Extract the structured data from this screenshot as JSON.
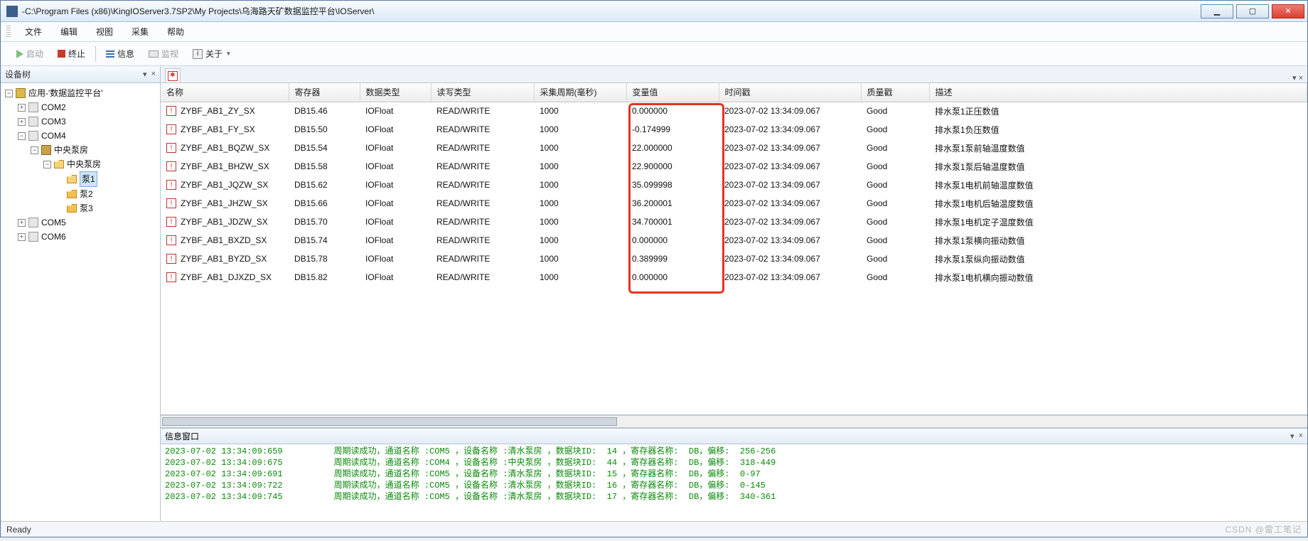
{
  "window": {
    "title": "-C:\\Program Files (x86)\\KingIOServer3.7SP2\\My Projects\\乌海路天矿数据监控平台\\IOServer\\",
    "min": "▁",
    "max": "▢",
    "close": "✕"
  },
  "menu": {
    "items": [
      "文件",
      "编辑",
      "视图",
      "采集",
      "帮助"
    ]
  },
  "toolbar": {
    "start": "启动",
    "stop": "终止",
    "info": "信息",
    "monitor": "监视",
    "about": "关于"
  },
  "sidebar": {
    "title": "设备树",
    "pin": "▾",
    "close": "×",
    "root": "应用-'数据监控平台'",
    "nodes": [
      "COM2",
      "COM3",
      "COM4",
      "COM5",
      "COM6"
    ],
    "com4": {
      "dev1": "中央泵房",
      "dev2": "中央泵房",
      "p1": "泵1",
      "p2": "泵2",
      "p3": "泵3"
    },
    "selected": "泵1"
  },
  "grid": {
    "headers": {
      "name": "名称",
      "reg": "寄存器",
      "dt": "数据类型",
      "rw": "读写类型",
      "per": "采集周期(毫秒)",
      "val": "变量值",
      "ts": "时间戳",
      "q": "质量戳",
      "desc": "描述"
    },
    "rows": [
      {
        "name": "ZYBF_AB1_ZY_SX",
        "reg": "DB15.46",
        "dt": "IOFloat",
        "rw": "READ/WRITE",
        "per": "1000",
        "val": "0.000000",
        "ts": "2023-07-02 13:34:09.067",
        "q": "Good",
        "desc": "排水泵1正压数值"
      },
      {
        "name": "ZYBF_AB1_FY_SX",
        "reg": "DB15.50",
        "dt": "IOFloat",
        "rw": "READ/WRITE",
        "per": "1000",
        "val": "-0.174999",
        "ts": "2023-07-02 13:34:09.067",
        "q": "Good",
        "desc": "排水泵1负压数值"
      },
      {
        "name": "ZYBF_AB1_BQZW_SX",
        "reg": "DB15.54",
        "dt": "IOFloat",
        "rw": "READ/WRITE",
        "per": "1000",
        "val": "22.000000",
        "ts": "2023-07-02 13:34:09.067",
        "q": "Good",
        "desc": "排水泵1泵前轴温度数值"
      },
      {
        "name": "ZYBF_AB1_BHZW_SX",
        "reg": "DB15.58",
        "dt": "IOFloat",
        "rw": "READ/WRITE",
        "per": "1000",
        "val": "22.900000",
        "ts": "2023-07-02 13:34:09.067",
        "q": "Good",
        "desc": "排水泵1泵后轴温度数值"
      },
      {
        "name": "ZYBF_AB1_JQZW_SX",
        "reg": "DB15.62",
        "dt": "IOFloat",
        "rw": "READ/WRITE",
        "per": "1000",
        "val": "35.099998",
        "ts": "2023-07-02 13:34:09.067",
        "q": "Good",
        "desc": "排水泵1电机前轴温度数值"
      },
      {
        "name": "ZYBF_AB1_JHZW_SX",
        "reg": "DB15.66",
        "dt": "IOFloat",
        "rw": "READ/WRITE",
        "per": "1000",
        "val": "36.200001",
        "ts": "2023-07-02 13:34:09.067",
        "q": "Good",
        "desc": "排水泵1电机后轴温度数值"
      },
      {
        "name": "ZYBF_AB1_JDZW_SX",
        "reg": "DB15.70",
        "dt": "IOFloat",
        "rw": "READ/WRITE",
        "per": "1000",
        "val": "34.700001",
        "ts": "2023-07-02 13:34:09.067",
        "q": "Good",
        "desc": "排水泵1电机定子温度数值"
      },
      {
        "name": "ZYBF_AB1_BXZD_SX",
        "reg": "DB15.74",
        "dt": "IOFloat",
        "rw": "READ/WRITE",
        "per": "1000",
        "val": "0.000000",
        "ts": "2023-07-02 13:34:09.067",
        "q": "Good",
        "desc": "排水泵1泵横向振动数值"
      },
      {
        "name": "ZYBF_AB1_BYZD_SX",
        "reg": "DB15.78",
        "dt": "IOFloat",
        "rw": "READ/WRITE",
        "per": "1000",
        "val": "0.389999",
        "ts": "2023-07-02 13:34:09.067",
        "q": "Good",
        "desc": "排水泵1泵纵向振动数值"
      },
      {
        "name": "ZYBF_AB1_DJXZD_SX",
        "reg": "DB15.82",
        "dt": "IOFloat",
        "rw": "READ/WRITE",
        "per": "1000",
        "val": "0.000000",
        "ts": "2023-07-02 13:34:09.067",
        "q": "Good",
        "desc": "排水泵1电机横向振动数值"
      }
    ]
  },
  "info": {
    "title": "信息窗口",
    "pin": "▾",
    "close": "×",
    "lines": [
      {
        "ts": "2023-07-02 13:34:09:659",
        "msg": "周期读成功，通道名称 :COM5 ，设备名称 :清水泵房 ，数据块ID:  14 ，寄存器名称:  DB，偏移:  256-256"
      },
      {
        "ts": "2023-07-02 13:34:09:675",
        "msg": "周期读成功，通道名称 :COM4 ，设备名称 :中央泵房 ，数据块ID:  44 ，寄存器名称:  DB，偏移:  318-449"
      },
      {
        "ts": "2023-07-02 13:34:09:691",
        "msg": "周期读成功，通道名称 :COM5 ，设备名称 :清水泵房 ，数据块ID:  15 ，寄存器名称:  DB，偏移:  0-97"
      },
      {
        "ts": "2023-07-02 13:34:09:722",
        "msg": "周期读成功，通道名称 :COM5 ，设备名称 :清水泵房 ，数据块ID:  16 ，寄存器名称:  DB，偏移:  0-145"
      },
      {
        "ts": "2023-07-02 13:34:09:745",
        "msg": "周期读成功，通道名称 :COM5 ，设备名称 :清水泵房 ，数据块ID:  17 ，寄存器名称:  DB，偏移:  340-361"
      }
    ]
  },
  "status": {
    "text": "Ready",
    "watermark": "CSDN @雷工笔记"
  },
  "glyph": {
    "plus": "+",
    "minus": "−",
    "tag": "!",
    "dd": "▾"
  }
}
